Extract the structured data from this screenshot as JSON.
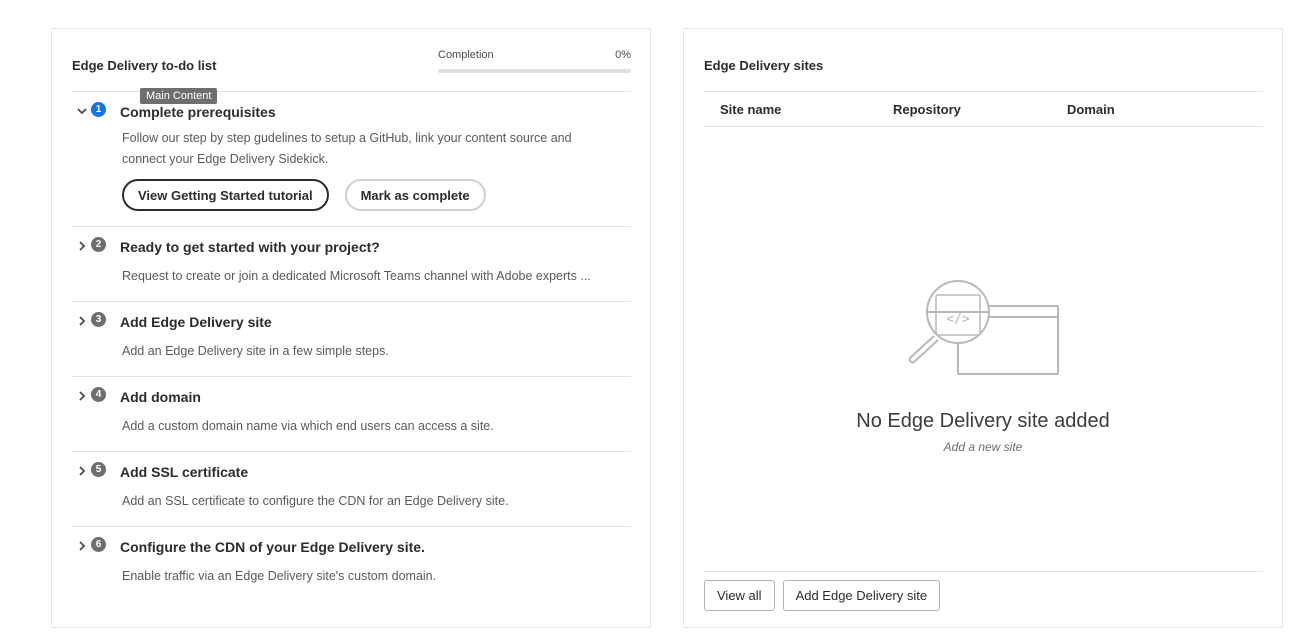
{
  "todo": {
    "title": "Edge Delivery to-do list",
    "completion_label": "Completion",
    "completion_value": "0%",
    "completion_fraction": 0,
    "tooltip": "Main Content",
    "accent_color": "#1473e6",
    "items": [
      {
        "number": "1",
        "title": "Complete prerequisites",
        "description": "Follow our step by step gudelines to setup a GitHub, link your content source and connect your Edge Delivery Sidekick.",
        "expanded": true,
        "buttons": [
          "View Getting Started tutorial",
          "Mark as complete"
        ]
      },
      {
        "number": "2",
        "title": "Ready to get started with your project?",
        "description": "Request to create or join a dedicated Microsoft Teams channel with Adobe experts ..."
      },
      {
        "number": "3",
        "title": "Add Edge Delivery site",
        "description": "Add an Edge Delivery site in a few simple steps."
      },
      {
        "number": "4",
        "title": "Add domain",
        "description": "Add a custom domain name via which end users can access a site."
      },
      {
        "number": "5",
        "title": "Add SSL certificate",
        "description": "Add an SSL certificate to configure the CDN for an Edge Delivery site."
      },
      {
        "number": "6",
        "title": "Configure the CDN of your Edge Delivery site.",
        "description": "Enable traffic via an Edge Delivery site's custom domain."
      }
    ]
  },
  "sites": {
    "title": "Edge Delivery sites",
    "columns": [
      "Site name",
      "Repository",
      "Domain"
    ],
    "empty_title": "No Edge Delivery site added",
    "empty_subtitle": "Add a new site",
    "illustration_icon": "code-search-icon",
    "view_all_label": "View all",
    "add_site_label": "Add Edge Delivery site"
  }
}
